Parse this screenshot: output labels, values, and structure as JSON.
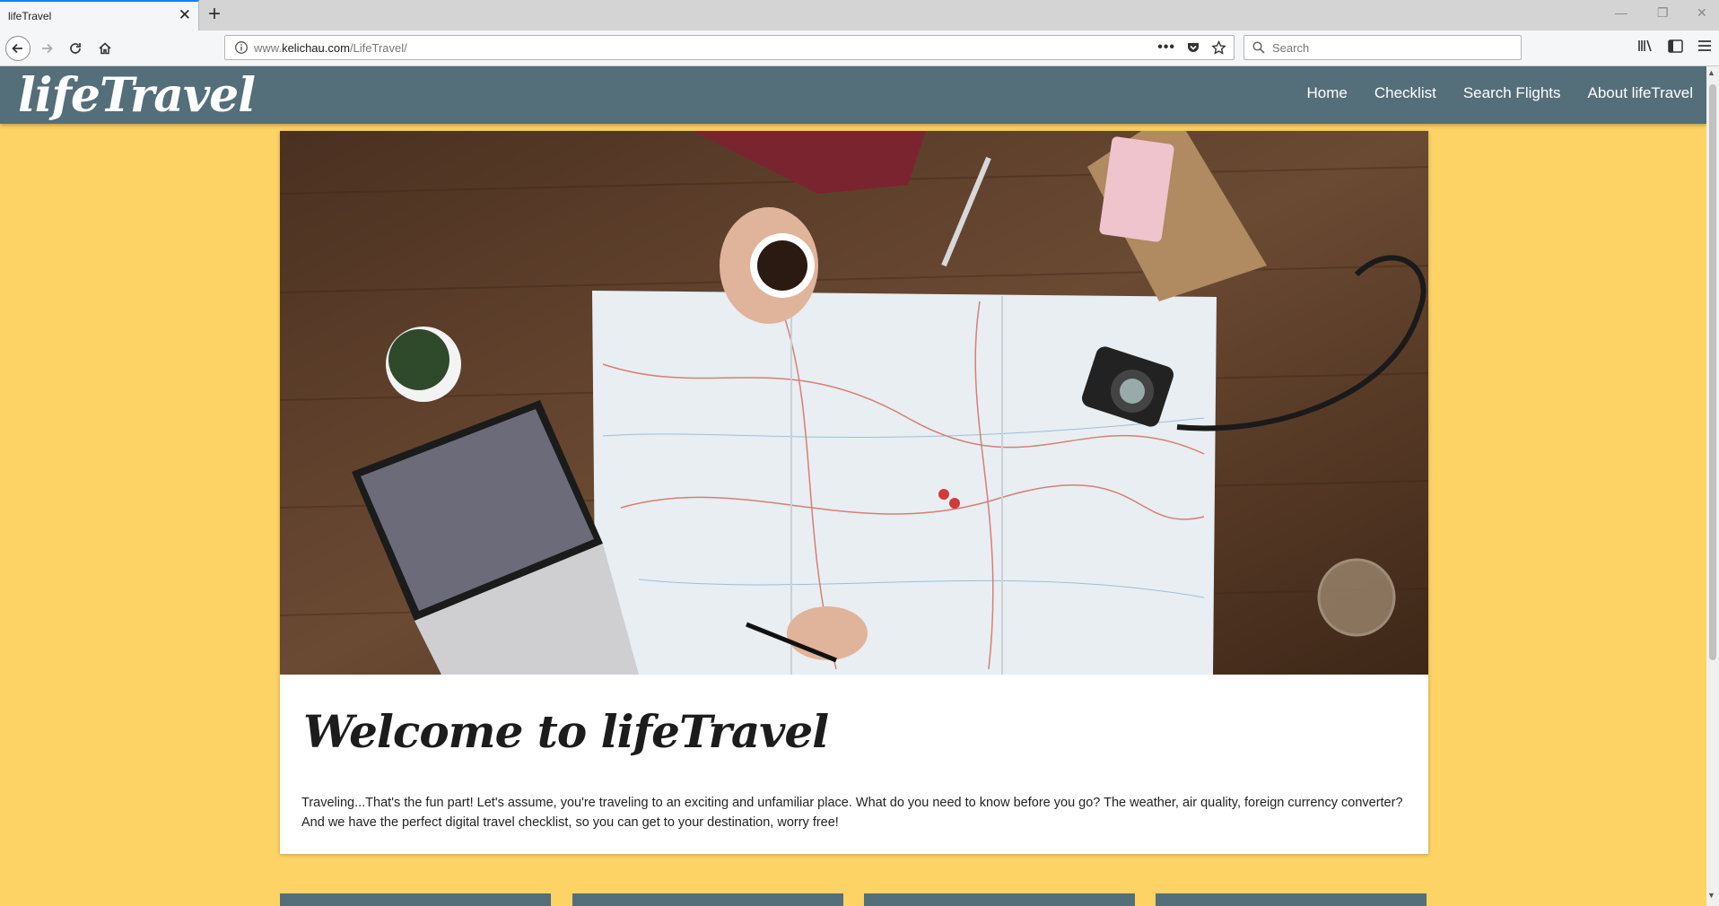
{
  "browser": {
    "tab_title": "lifeTravel",
    "url_prefix": "www.",
    "url_domain": "kelichau.com",
    "url_path": "/LifeTravel/",
    "search_placeholder": "Search"
  },
  "site": {
    "logo": "lifeTravel",
    "nav": [
      "Home",
      "Checklist",
      "Search Flights",
      "About lifeTravel"
    ],
    "welcome_title": "Welcome to lifeTravel",
    "intro": "Traveling...That's the fun part! Let's assume, you're traveling to an exciting and unfamiliar place. What do you need to know before you go? The weather, air quality, foreign currency converter? And we have the perfect digital travel checklist, so you can get to your destination, worry free!",
    "hero_image": "travel-desk-map-laptop-camera-photo"
  },
  "colors": {
    "page_background": "#fdd365",
    "header_background": "#546e7a",
    "card_background": "#ffffff"
  }
}
